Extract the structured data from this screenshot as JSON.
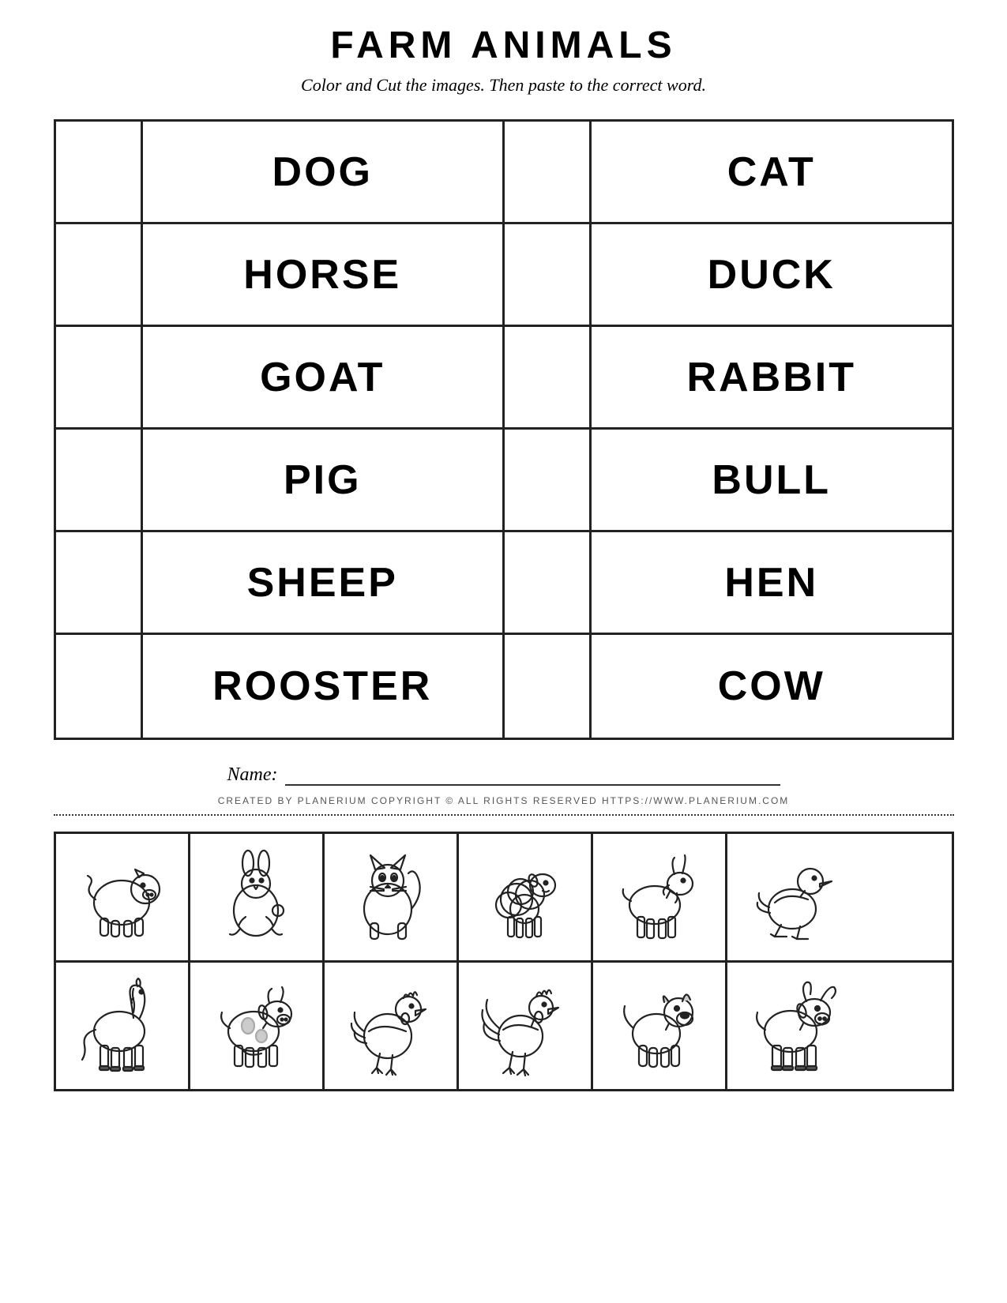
{
  "title": "FARM ANIMALS",
  "subtitle": "Color and Cut the images. Then paste to the correct word.",
  "left_column": [
    {
      "word": "DOG"
    },
    {
      "word": "HORSE"
    },
    {
      "word": "GOAT"
    },
    {
      "word": "PIG"
    },
    {
      "word": "SHEEP"
    },
    {
      "word": "ROOSTER"
    }
  ],
  "right_column": [
    {
      "word": "CAT"
    },
    {
      "word": "DUCK"
    },
    {
      "word": "RABBIT"
    },
    {
      "word": "BULL"
    },
    {
      "word": "HEN"
    },
    {
      "word": "COW"
    }
  ],
  "name_label": "Name:",
  "copyright": "CREATED BY PLANERIUM COPYRIGHT © ALL RIGHTS RESERVED   HTTPS://WWW.PLANERIUM.COM"
}
